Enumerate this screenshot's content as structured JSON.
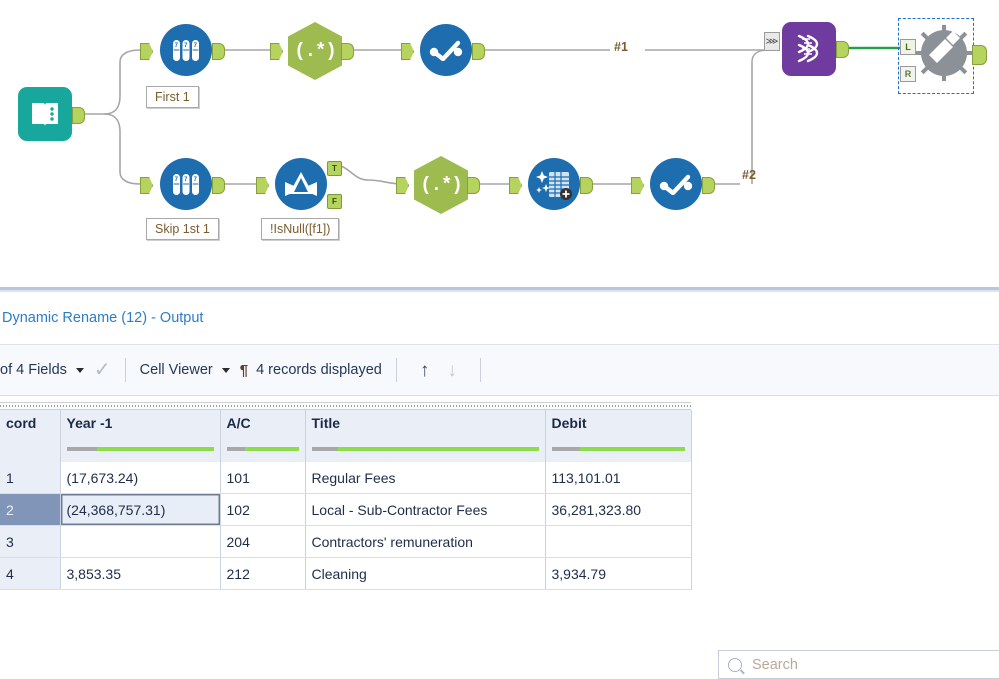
{
  "canvas": {
    "tools": [
      {
        "id": "input-data",
        "type": "input",
        "icon": "book-icon",
        "label": ""
      },
      {
        "id": "sample-1",
        "type": "sample",
        "icon": "test-tubes-icon",
        "label": "First 1"
      },
      {
        "id": "formula-1",
        "type": "regex",
        "icon": "regex-icon",
        "glyph": "(.*)",
        "label": ""
      },
      {
        "id": "select-1",
        "type": "select",
        "icon": "select-check-icon",
        "label": ""
      },
      {
        "id": "sample-2",
        "type": "sample",
        "icon": "test-tubes-icon",
        "label": "Skip 1st 1"
      },
      {
        "id": "filter-1",
        "type": "filter",
        "icon": "filter-funnel-icon",
        "label": "!IsNull([f1])"
      },
      {
        "id": "formula-2",
        "type": "regex",
        "icon": "regex-icon",
        "glyph": "(.*)",
        "label": ""
      },
      {
        "id": "datacleanse-1",
        "type": "cleanse",
        "icon": "data-cleansing-icon",
        "label": ""
      },
      {
        "id": "select-2",
        "type": "select",
        "icon": "select-check-icon",
        "label": ""
      },
      {
        "id": "union-1",
        "type": "union",
        "icon": "dna-helix-icon",
        "label": ""
      },
      {
        "id": "dynamic-rename",
        "type": "rename",
        "icon": "gear-pencil-icon",
        "label": "",
        "selected": true
      }
    ],
    "connection_labels": [
      "#1",
      "#2"
    ],
    "filter_ports": {
      "true": "T",
      "false": "F"
    },
    "rename_ports": {
      "left": "L",
      "right": "R"
    },
    "colors": {
      "tool_blue": "#1d6daf",
      "tool_green": "#9dbb4e",
      "tool_teal": "#18a79c",
      "tool_purple": "#6f3b9e",
      "tool_gray": "#8b9196",
      "connector_green": "#b6d35e",
      "selection_blue": "#1f6fd0",
      "annotation_text": "#7a5c2e"
    }
  },
  "results": {
    "title": "Dynamic Rename (12) - Output",
    "toolbar": {
      "fields_label": "of 4 Fields",
      "check_icon": "checkmark-icon",
      "cell_viewer_label": "Cell Viewer",
      "pilcrow_icon": "pilcrow-icon",
      "records_label": "4 records displayed",
      "up_arrow": "↑",
      "down_arrow": "↓"
    },
    "search": {
      "placeholder": "Search",
      "value": "",
      "icon": "search-icon"
    },
    "grid": {
      "columns": [
        "cord",
        "Year -1",
        "A/C",
        "Title",
        "Debit"
      ],
      "selected_row": 2,
      "rows": [
        {
          "num": "1",
          "year": "(17,673.24)",
          "ac": "101",
          "title": "Regular Fees",
          "debit": "113,101.01"
        },
        {
          "num": "2",
          "year": "(24,368,757.31)",
          "ac": "102",
          "title": "Local - Sub-Contractor Fees",
          "debit": "36,281,323.80"
        },
        {
          "num": "3",
          "year": "",
          "ac": "204",
          "title": "Contractors' remuneration",
          "debit": ""
        },
        {
          "num": "4",
          "year": "3,853.35",
          "ac": "212",
          "title": "Cleaning",
          "debit": "3,934.79"
        }
      ]
    }
  }
}
